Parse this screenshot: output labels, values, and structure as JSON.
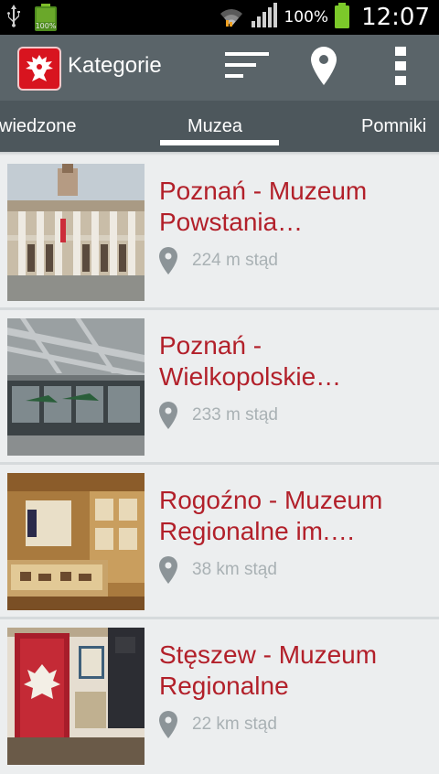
{
  "status_bar": {
    "battery_percent": "100%",
    "time": "12:07",
    "icons": [
      "usb-icon",
      "battery-full-icon",
      "wifi-icon",
      "signal-icon",
      "battery-icon"
    ],
    "small_battery_label": "100%"
  },
  "action_bar": {
    "title": "Kategorie",
    "icons": [
      "app-logo-eagle-icon",
      "sort-icon",
      "location-pin-icon",
      "overflow-menu-icon"
    ]
  },
  "tabs": {
    "items": [
      {
        "label": "Odwiedzone",
        "visible": "wiedzone"
      },
      {
        "label": "Muzea",
        "visible": "Muzea",
        "selected": true
      },
      {
        "label": "Pomniki",
        "visible": "Pomniki"
      }
    ]
  },
  "list": {
    "items": [
      {
        "title": "Poznań - Muzeum Powstania…",
        "distance": "224 m stąd",
        "pin_icon": "location-pin-icon"
      },
      {
        "title": "Poznań - Wielkopolskie…",
        "distance": "233 m stąd",
        "pin_icon": "location-pin-icon"
      },
      {
        "title": "Rogoźno - Muzeum Regionalne im.…",
        "distance": "38 km stąd",
        "pin_icon": "location-pin-icon"
      },
      {
        "title": "Stęszew - Muzeum Regionalne",
        "distance": "22 km stąd",
        "pin_icon": "location-pin-icon"
      }
    ]
  },
  "colors": {
    "title_red": "#b2202a",
    "action_bar": "#5a6469",
    "tab_bar": "#4d575c",
    "list_bg": "#eceeef",
    "distance_gray": "#a9b1b4"
  }
}
